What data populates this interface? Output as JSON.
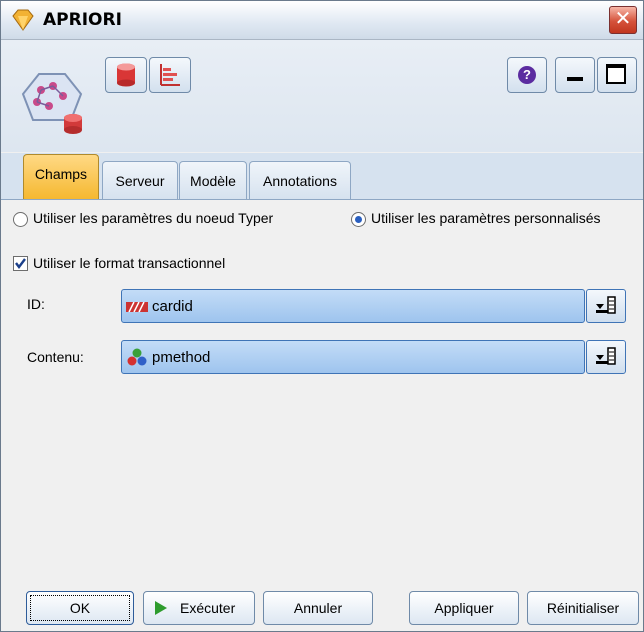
{
  "window": {
    "title": "APRIORI",
    "close_glyph": "✕"
  },
  "toolbar": {
    "icons": [
      "database-icon",
      "chart-icon",
      "help-icon",
      "minimize-icon",
      "maximize-icon"
    ],
    "help_glyph": "?"
  },
  "tabs": [
    {
      "label": "Champs",
      "active": true
    },
    {
      "label": "Serveur",
      "active": false
    },
    {
      "label": "Modèle",
      "active": false
    },
    {
      "label": "Annotations",
      "active": false
    }
  ],
  "fields": {
    "radio_type_node": {
      "label": "Utiliser les paramètres du noeud Typer",
      "selected": false
    },
    "radio_custom": {
      "label": "Utiliser les paramètres personnalisés",
      "selected": true
    },
    "transactional": {
      "label": "Utiliser le format transactionnel",
      "checked": true
    },
    "id": {
      "label": "ID:",
      "value": "cardid"
    },
    "content": {
      "label": "Contenu:",
      "value": "pmethod"
    }
  },
  "buttons": {
    "ok": "OK",
    "execute": "Exécuter",
    "cancel": "Annuler",
    "apply": "Appliquer",
    "reset": "Réinitialiser"
  },
  "colors": {
    "accent_tab": "#f5b830",
    "field_bg": "#9ec4ee",
    "close_btn": "#c1361e"
  }
}
